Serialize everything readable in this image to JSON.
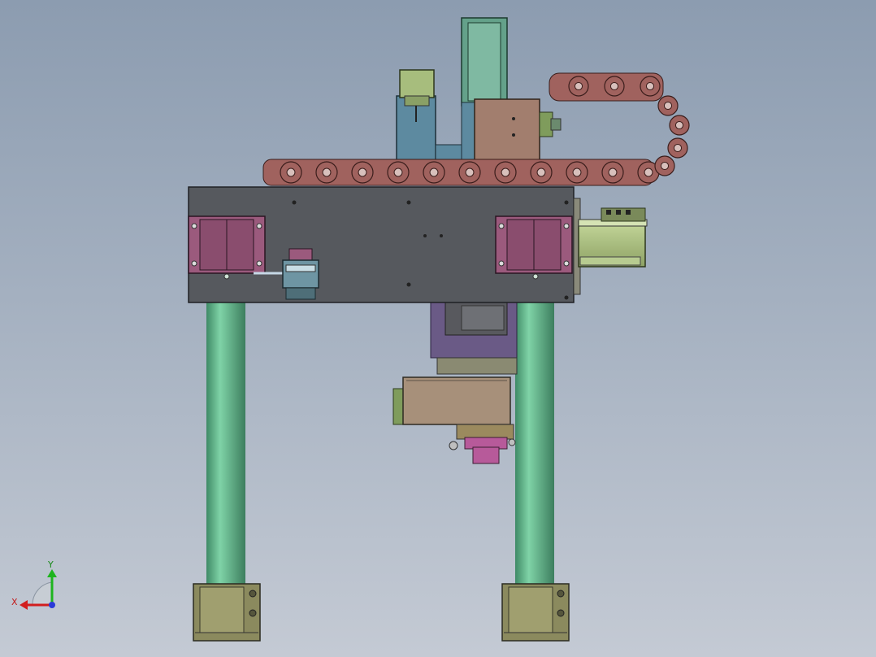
{
  "viewport": {
    "background_top": "#8c9cb0",
    "background_bottom": "#c4cad4"
  },
  "model": {
    "colors": {
      "column": "#5fb68a",
      "base_plate": "#56595e",
      "linear_block": "#9b5a7d",
      "cable_chain": "#a0625e",
      "motor_green": "#a7bd7d",
      "motor_housing": "#a27e6e",
      "gripper_body": "#a7907a",
      "mount_blue": "#5d8aa0",
      "foot": "#8b8a5e"
    }
  },
  "triad": {
    "x_label": "X",
    "y_label": "Y",
    "x_color": "#d21e1e",
    "y_color": "#1eb41e",
    "z_color": "#2a3ad8"
  }
}
